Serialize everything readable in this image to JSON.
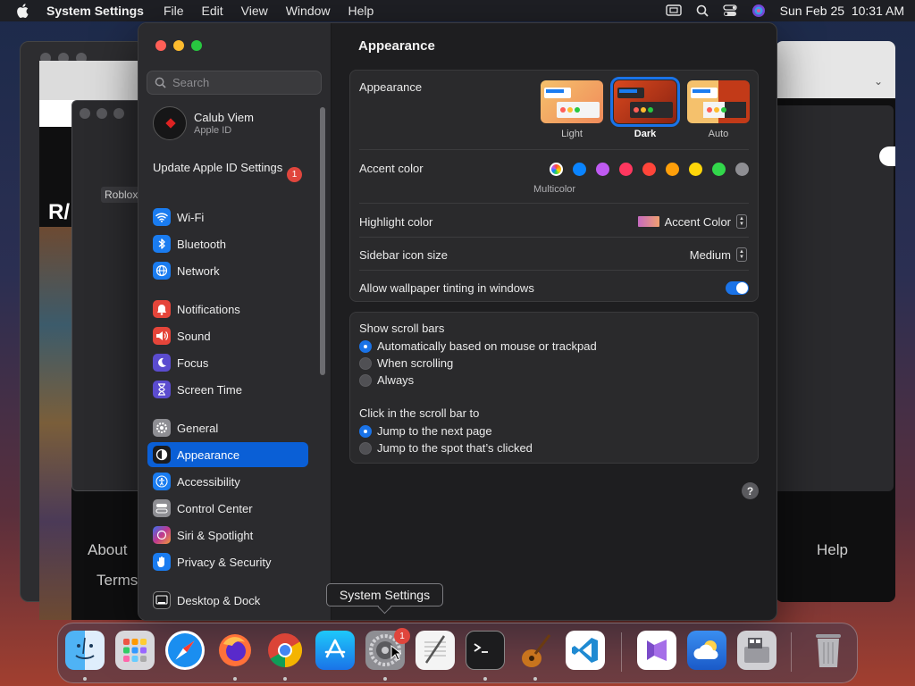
{
  "menubar": {
    "app_name": "System Settings",
    "items": [
      "File",
      "Edit",
      "View",
      "Window",
      "Help"
    ],
    "datetime": "Sun Feb 25  10:31 AM"
  },
  "background": {
    "roblox_label": "Roblox",
    "logo_text": "R/",
    "about": "About",
    "terms": "Terms",
    "help": "Help"
  },
  "sidebar": {
    "search_placeholder": "Search",
    "profile": {
      "name": "Calub Viem",
      "subtitle": "Apple ID"
    },
    "update": {
      "label": "Update Apple ID Settings",
      "badge": "1"
    },
    "items": [
      {
        "label": "Wi-Fi",
        "icon": "wifi-icon",
        "color": "#1a7cf0"
      },
      {
        "label": "Bluetooth",
        "icon": "bluetooth-icon",
        "color": "#1a7cf0"
      },
      {
        "label": "Network",
        "icon": "globe-icon",
        "color": "#1a7cf0"
      },
      {
        "label": "Notifications",
        "icon": "bell-icon",
        "color": "#e5453a"
      },
      {
        "label": "Sound",
        "icon": "speaker-icon",
        "color": "#e5453a"
      },
      {
        "label": "Focus",
        "icon": "moon-icon",
        "color": "#5b4ccf"
      },
      {
        "label": "Screen Time",
        "icon": "hourglass-icon",
        "color": "#5b4ccf"
      },
      {
        "label": "General",
        "icon": "gear-icon",
        "color": "#8e8e93"
      },
      {
        "label": "Appearance",
        "icon": "appearance-icon",
        "color": "#1c1c1e"
      },
      {
        "label": "Accessibility",
        "icon": "accessibility-icon",
        "color": "#1a7cf0"
      },
      {
        "label": "Control Center",
        "icon": "control-center-icon",
        "color": "#8e8e93"
      },
      {
        "label": "Siri & Spotlight",
        "icon": "siri-icon",
        "color": "#c0398f"
      },
      {
        "label": "Privacy & Security",
        "icon": "hand-icon",
        "color": "#1a7cf0"
      },
      {
        "label": "Desktop & Dock",
        "icon": "desktop-icon",
        "color": "#1c1c1e"
      }
    ],
    "selected": "Appearance"
  },
  "detail": {
    "title": "Appearance",
    "appearance": {
      "label": "Appearance",
      "options": [
        "Light",
        "Dark",
        "Auto"
      ],
      "selected": "Dark"
    },
    "accent": {
      "label": "Accent color",
      "swatches": [
        "#multicolor",
        "#0a84ff",
        "#bf5af2",
        "#ff375f",
        "#ff453a",
        "#ff9f0a",
        "#ffd60a",
        "#32d74b",
        "#8e8e93"
      ],
      "selected_caption": "Multicolor"
    },
    "highlight": {
      "label": "Highlight color",
      "value": "Accent Color"
    },
    "sidebar_icon": {
      "label": "Sidebar icon size",
      "value": "Medium"
    },
    "tinting": {
      "label": "Allow wallpaper tinting in windows",
      "on": true
    },
    "scroll_bars": {
      "label": "Show scroll bars",
      "options": [
        "Automatically based on mouse or trackpad",
        "When scrolling",
        "Always"
      ],
      "selected": 0
    },
    "click_scroll": {
      "label": "Click in the scroll bar to",
      "options": [
        "Jump to the next page",
        "Jump to the spot that’s clicked"
      ],
      "selected": 0
    },
    "help": "?"
  },
  "tooltip": "System Settings",
  "dock": {
    "apps": [
      "Finder",
      "Launchpad",
      "Safari",
      "Firefox",
      "Chrome",
      "App Store",
      "System Settings",
      "TextEdit",
      "Terminal",
      "GarageBand",
      "Visual Studio Code",
      "Visual Studio",
      "Weather",
      "Boot Camp",
      "Trash"
    ],
    "settings_badge": "1"
  }
}
